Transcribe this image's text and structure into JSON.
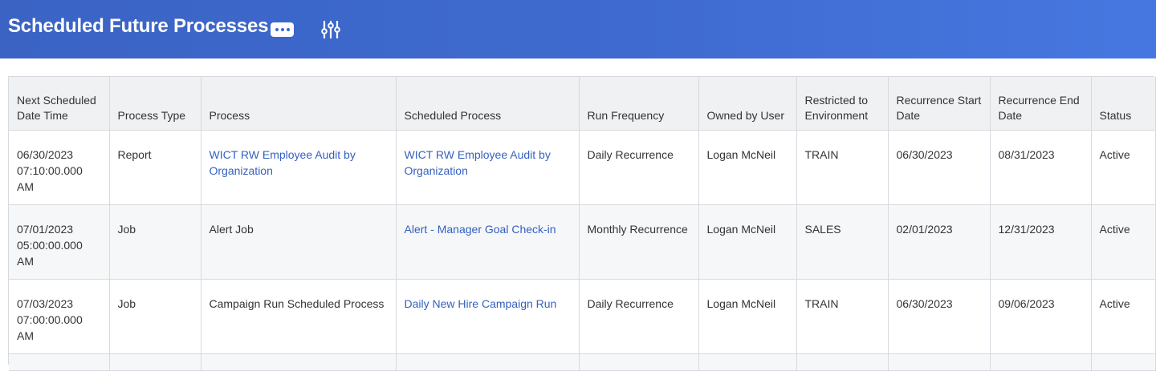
{
  "header": {
    "title": "Scheduled Future Processes",
    "more_icon": "ellipsis-icon",
    "filter_icon": "filter-sliders-icon",
    "background": "#3f6bd0"
  },
  "table": {
    "columns": [
      "Next Scheduled Date Time",
      "Process Type",
      "Process",
      "Scheduled Process",
      "Run Frequency",
      "Owned by User",
      "Restricted to Environment",
      "Recurrence Start Date",
      "Recurrence End Date",
      "Status"
    ],
    "rows": [
      {
        "next_scheduled": "06/30/2023 07:10:00.000 AM",
        "process_type": "Report",
        "process": "WICT RW Employee Audit by Organization",
        "process_is_link": true,
        "scheduled_process": "WICT RW Employee Audit by Organization",
        "run_frequency": "Daily Recurrence",
        "owned_by": "Logan McNeil",
        "environment": "TRAIN",
        "start_date": "06/30/2023",
        "end_date": "08/31/2023",
        "status": "Active"
      },
      {
        "next_scheduled": "07/01/2023 05:00:00.000 AM",
        "process_type": "Job",
        "process": "Alert Job",
        "process_is_link": false,
        "scheduled_process": "Alert - Manager Goal Check-in",
        "run_frequency": "Monthly Recurrence",
        "owned_by": "Logan McNeil",
        "environment": "SALES",
        "start_date": "02/01/2023",
        "end_date": "12/31/2023",
        "status": "Active"
      },
      {
        "next_scheduled": "07/03/2023 07:00:00.000 AM",
        "process_type": "Job",
        "process": "Campaign Run Scheduled Process",
        "process_is_link": false,
        "scheduled_process": "Daily New Hire Campaign Run",
        "run_frequency": "Daily Recurrence",
        "owned_by": "Logan McNeil",
        "environment": "TRAIN",
        "start_date": "06/30/2023",
        "end_date": "09/06/2023",
        "status": "Active"
      }
    ]
  }
}
